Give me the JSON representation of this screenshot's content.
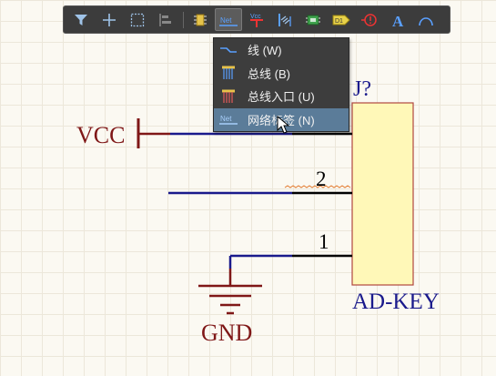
{
  "toolbar": {
    "buttons": [
      {
        "name": "filter",
        "icon": "filter-icon"
      },
      {
        "name": "crosshair",
        "icon": "crosshair-icon"
      },
      {
        "name": "select-rect",
        "icon": "select-rect-icon"
      },
      {
        "name": "align",
        "icon": "align-icon"
      },
      {
        "name": "component",
        "icon": "component-icon"
      },
      {
        "name": "net-label",
        "icon": "net-label-icon",
        "label": "Net",
        "active": true
      },
      {
        "name": "power-port",
        "icon": "power-port-icon",
        "label": "Vcc"
      },
      {
        "name": "bus-entry",
        "icon": "bus-entry-icon"
      },
      {
        "name": "part",
        "icon": "part-icon"
      },
      {
        "name": "port",
        "icon": "port-icon",
        "label": "D1"
      },
      {
        "name": "no-erc",
        "icon": "no-erc-icon"
      },
      {
        "name": "text",
        "icon": "text-icon",
        "label": "A"
      },
      {
        "name": "arc",
        "icon": "arc-icon"
      }
    ]
  },
  "menu": {
    "items": [
      {
        "label": "线 (W)",
        "icon": "wire-icon"
      },
      {
        "label": "总线 (B)",
        "icon": "bus-icon"
      },
      {
        "label": "总线入口 (U)",
        "icon": "bus-entry-icon"
      },
      {
        "label": "网络标签 (N)",
        "icon": "net-label-icon",
        "icon_text": "Net",
        "highlighted": true
      }
    ]
  },
  "schematic": {
    "designator": "J?",
    "comment": "AD-KEY",
    "pin_2": "2",
    "pin_1": "1",
    "power_label": "VCC",
    "ground_label": "GND"
  },
  "colors": {
    "wire": "#1a1a8c",
    "pin": "#000000",
    "power": "#7f1717",
    "component_fill": "#fff8b8",
    "component_border": "#b0473f",
    "designator": "#1a1a8c",
    "menu_highlight": "#5b7c99",
    "toolbar_bg": "#3c3c3c"
  }
}
